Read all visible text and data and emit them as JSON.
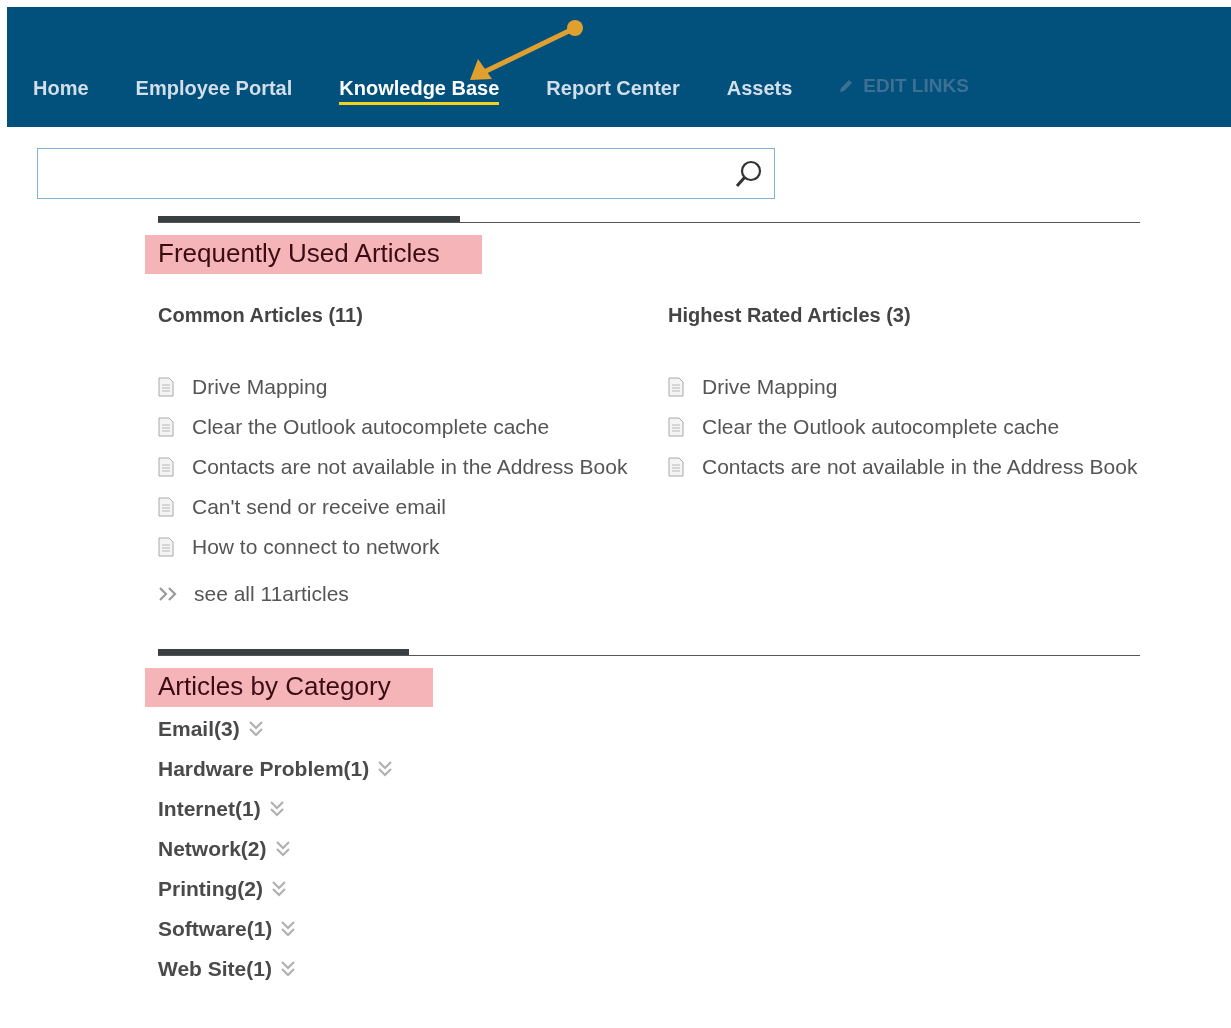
{
  "nav": {
    "items": [
      {
        "label": "Home",
        "selected": false
      },
      {
        "label": "Employee Portal",
        "selected": false
      },
      {
        "label": "Knowledge Base",
        "selected": true
      },
      {
        "label": "Report Center",
        "selected": false
      },
      {
        "label": "Assets",
        "selected": false
      }
    ],
    "edit_links": {
      "label": "EDIT LINKS",
      "disabled": true
    }
  },
  "sections": [
    {
      "kind": "articles",
      "title": "Frequently Used Articles",
      "columns": [
        {
          "title": "Common Articles (11)",
          "articles": [
            "Drive Mapping",
            "Clear the Outlook autocomplete cache",
            "Contacts are not available in the Address Book",
            "Can't send or receive email",
            "How to connect to network"
          ],
          "see_all": "see all 11articles"
        },
        {
          "title": "Highest Rated Articles (3)",
          "articles": [
            "Drive Mapping",
            "Clear the Outlook autocomplete cache",
            "Contacts are not available in the Address Book"
          ]
        }
      ]
    },
    {
      "kind": "categories",
      "title": "Articles by Category",
      "categories": [
        "Email(3)",
        "Hardware Problem(1)",
        "Internet(1)",
        "Network(2)",
        "Printing(2)",
        "Software(1)",
        "Web Site(1)"
      ]
    }
  ]
}
